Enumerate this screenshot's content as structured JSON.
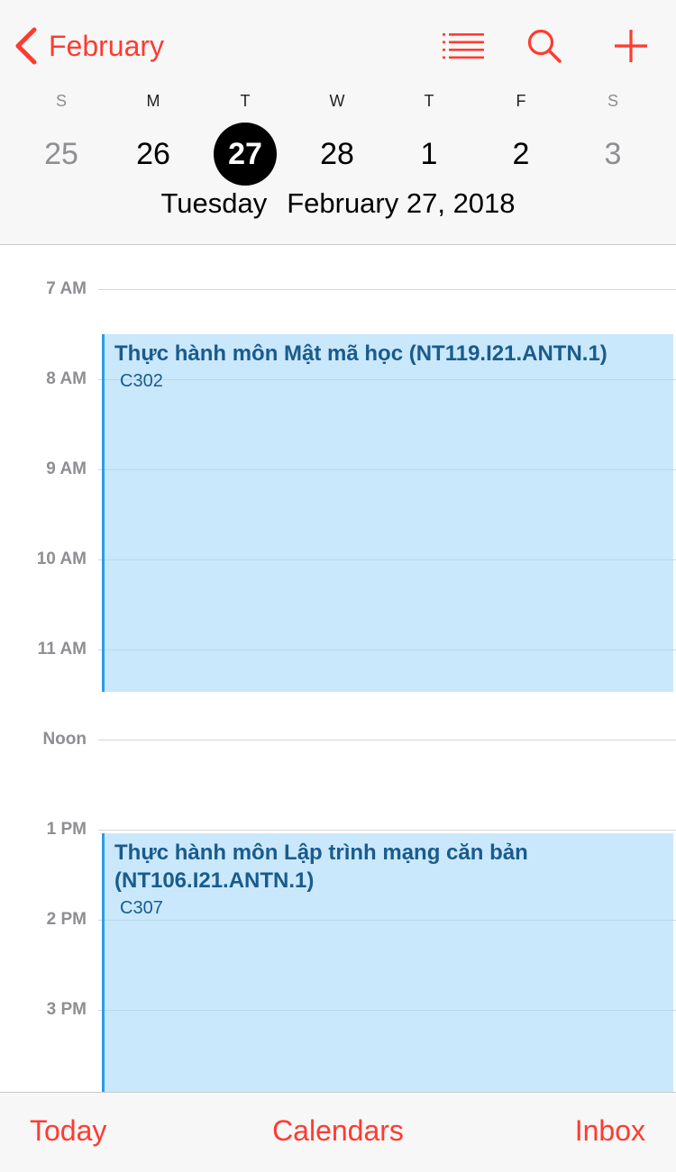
{
  "header": {
    "back_label": "February",
    "weekdays": [
      {
        "letter": "S",
        "weekend": true
      },
      {
        "letter": "M",
        "weekend": false
      },
      {
        "letter": "T",
        "weekend": false
      },
      {
        "letter": "W",
        "weekend": false
      },
      {
        "letter": "T",
        "weekend": false
      },
      {
        "letter": "F",
        "weekend": false
      },
      {
        "letter": "S",
        "weekend": true
      }
    ],
    "days": [
      {
        "num": "25",
        "weekend": true,
        "selected": false
      },
      {
        "num": "26",
        "weekend": false,
        "selected": false
      },
      {
        "num": "27",
        "weekend": false,
        "selected": true
      },
      {
        "num": "28",
        "weekend": false,
        "selected": false
      },
      {
        "num": "1",
        "weekend": false,
        "selected": false
      },
      {
        "num": "2",
        "weekend": false,
        "selected": false
      },
      {
        "num": "3",
        "weekend": true,
        "selected": false
      }
    ],
    "selected_weekday": "Tuesday",
    "selected_date": "February 27, 2018",
    "icons": {
      "back": "chevron-left-icon",
      "list": "list-icon",
      "search": "search-icon",
      "add": "plus-icon"
    }
  },
  "timeline": {
    "hours": [
      "7 AM",
      "8 AM",
      "9 AM",
      "10 AM",
      "11 AM",
      "Noon",
      "1 PM",
      "2 PM",
      "3 PM"
    ],
    "events": [
      {
        "title": "Thực hành môn Mật mã học (NT119.I21.ANTN.1)",
        "location": "C302",
        "start": 7.5,
        "end": 11.47
      },
      {
        "title": "Thực hành môn Lập trình mạng căn bản (NT106.I21.ANTN.1)",
        "location": "C307",
        "start": 13.04,
        "end": 16.0
      }
    ]
  },
  "toolbar": {
    "today": "Today",
    "calendars": "Calendars",
    "inbox": "Inbox"
  },
  "colors": {
    "accent": "#ff3b30",
    "event_fill": "#c5e6fb",
    "event_bar": "#2e9be6",
    "event_text": "#1a5b8c",
    "weekend": "#8e8e93"
  }
}
